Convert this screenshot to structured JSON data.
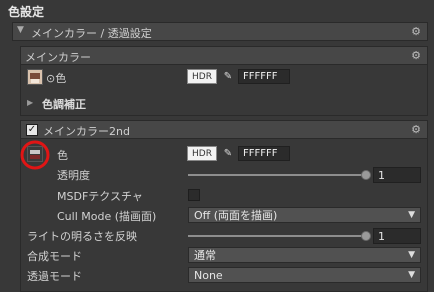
{
  "panel_title": "色設定",
  "section": {
    "title": "メインカラー / 透過設定"
  },
  "main_color": {
    "header": "メインカラー",
    "color_label": "⊙色",
    "hdr_label": "HDR",
    "hex_value": "FFFFFF",
    "tone_correction_label": "色調補正"
  },
  "main_color_2nd": {
    "header": "メインカラー2nd",
    "enabled": true,
    "color_label": "色",
    "hdr_label": "HDR",
    "hex_value": "FFFFFF",
    "opacity_label": "透明度",
    "opacity_value": "1",
    "msdf_label": "MSDFテクスチャ",
    "msdf_enabled": false,
    "cull_mode_label": "Cull Mode (描画面)",
    "cull_mode_value": "Off (両面を描画)",
    "light_label": "ライトの明るさを反映",
    "light_value": "1",
    "blend_mode_label": "合成モード",
    "blend_mode_value": "通常",
    "alpha_mode_label": "透過モード",
    "alpha_mode_value": "None"
  },
  "colors": {
    "background": "#383838",
    "highlight_circle": "#e01515"
  }
}
